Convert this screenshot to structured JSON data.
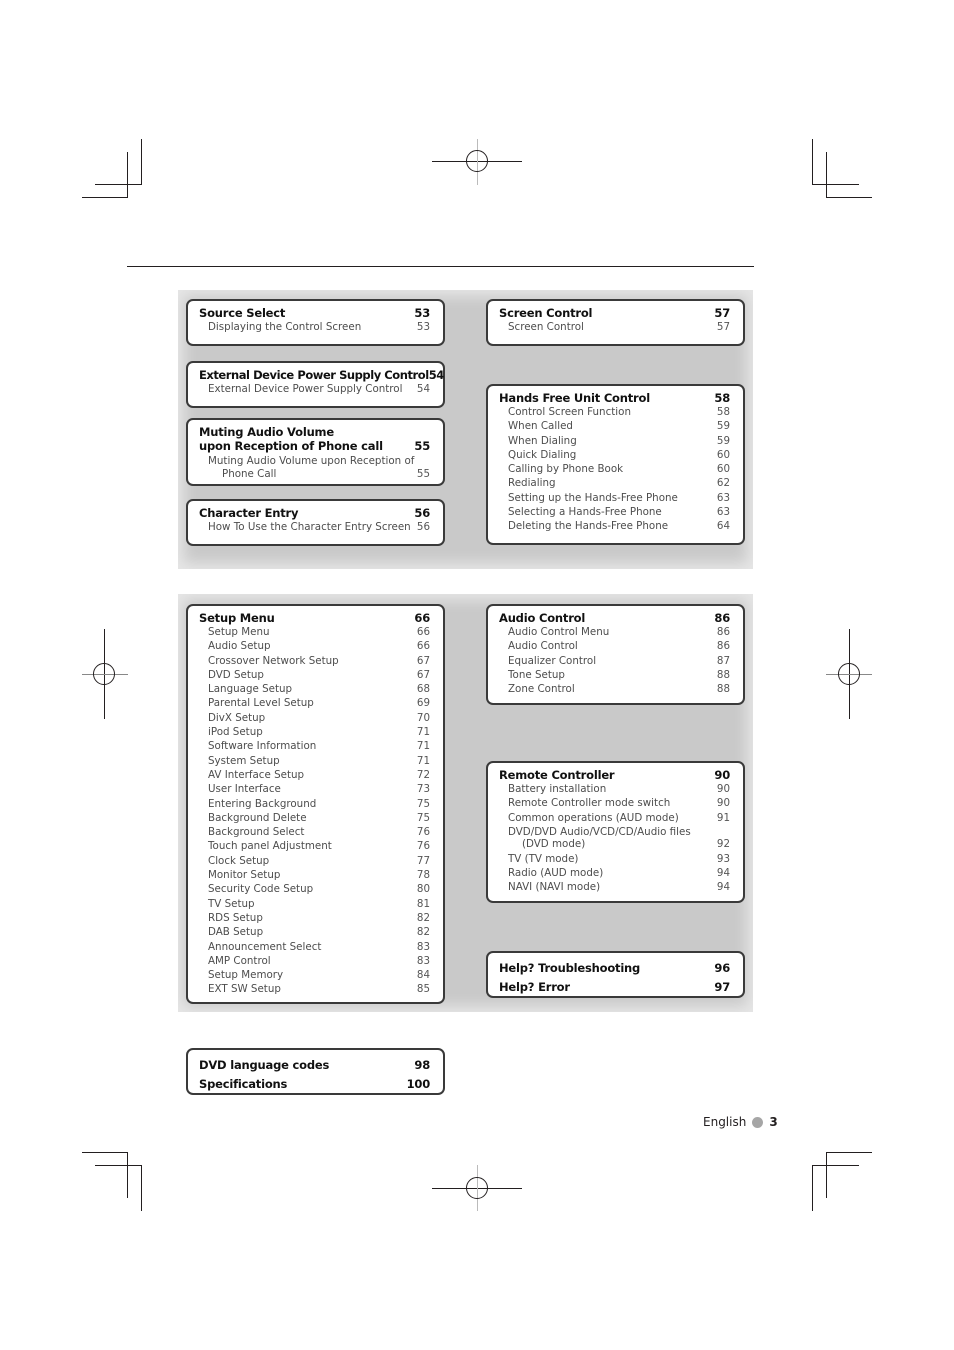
{
  "toc": {
    "group1_left": [
      {
        "title": "Source Select",
        "page": "53",
        "items": [
          {
            "label": "Displaying the Control Screen",
            "page": "53"
          }
        ]
      },
      {
        "title": "External Device Power Supply Control",
        "page": "54",
        "items": [
          {
            "label": "External Device Power Supply Control",
            "page": "54"
          }
        ]
      },
      {
        "title_line1": "Muting Audio Volume",
        "title_line2": "upon Reception of Phone call",
        "page": "55",
        "items": [
          {
            "label_line1": "Muting Audio Volume upon Reception of",
            "label_line2": "Phone Call",
            "page": "55"
          }
        ]
      },
      {
        "title": "Character Entry",
        "page": "56",
        "items": [
          {
            "label": "How To Use the Character Entry Screen",
            "page": "56"
          }
        ]
      }
    ],
    "group1_right": [
      {
        "title": "Screen Control",
        "page": "57",
        "items": [
          {
            "label": "Screen Control",
            "page": "57"
          }
        ]
      },
      {
        "title": "Hands Free Unit Control",
        "page": "58",
        "items": [
          {
            "label": "Control Screen Function",
            "page": "58"
          },
          {
            "label": "When Called",
            "page": "59"
          },
          {
            "label": "When Dialing",
            "page": "59"
          },
          {
            "label": "Quick Dialing",
            "page": "60"
          },
          {
            "label": "Calling by Phone Book",
            "page": "60"
          },
          {
            "label": "Redialing",
            "page": "62"
          },
          {
            "label": "Setting up the Hands-Free Phone",
            "page": "63"
          },
          {
            "label": "Selecting a Hands-Free Phone",
            "page": "63"
          },
          {
            "label": "Deleting the Hands-Free Phone",
            "page": "64"
          }
        ]
      }
    ],
    "group2_left": [
      {
        "title": "Setup Menu",
        "page": "66",
        "items": [
          {
            "label": "Setup Menu",
            "page": "66"
          },
          {
            "label": "Audio Setup",
            "page": "66"
          },
          {
            "label": "Crossover Network Setup",
            "page": "67"
          },
          {
            "label": "DVD Setup",
            "page": "67"
          },
          {
            "label": "Language Setup",
            "page": "68"
          },
          {
            "label": "Parental Level Setup",
            "page": "69"
          },
          {
            "label": "DivX Setup",
            "page": "70"
          },
          {
            "label": "iPod Setup",
            "page": "71"
          },
          {
            "label": "Software Information",
            "page": "71"
          },
          {
            "label": "System Setup",
            "page": "71"
          },
          {
            "label": "AV Interface Setup",
            "page": "72"
          },
          {
            "label": "User Interface",
            "page": "73"
          },
          {
            "label": "Entering Background",
            "page": "75"
          },
          {
            "label": "Background Delete",
            "page": "75"
          },
          {
            "label": "Background Select",
            "page": "76"
          },
          {
            "label": "Touch panel Adjustment",
            "page": "76"
          },
          {
            "label": "Clock Setup",
            "page": "77"
          },
          {
            "label": "Monitor Setup",
            "page": "78"
          },
          {
            "label": "Security Code Setup",
            "page": "80"
          },
          {
            "label": "TV Setup",
            "page": "81"
          },
          {
            "label": "RDS Setup",
            "page": "82"
          },
          {
            "label": "DAB Setup",
            "page": "82"
          },
          {
            "label": "Announcement Select",
            "page": "83"
          },
          {
            "label": "AMP Control",
            "page": "83"
          },
          {
            "label": "Setup Memory",
            "page": "84"
          },
          {
            "label": "EXT SW Setup",
            "page": "85"
          }
        ]
      }
    ],
    "group2_right": [
      {
        "title": "Audio Control",
        "page": "86",
        "items": [
          {
            "label": "Audio Control Menu",
            "page": "86"
          },
          {
            "label": "Audio Control",
            "page": "86"
          },
          {
            "label": "Equalizer Control",
            "page": "87"
          },
          {
            "label": "Tone Setup",
            "page": "88"
          },
          {
            "label": "Zone Control",
            "page": "88"
          }
        ]
      },
      {
        "title": "Remote Controller",
        "page": "90",
        "items": [
          {
            "label": "Battery installation",
            "page": "90"
          },
          {
            "label": "Remote Controller mode switch",
            "page": "90"
          },
          {
            "label": "Common operations (AUD mode)",
            "page": "91"
          },
          {
            "label_line1": "DVD/DVD Audio/VCD/CD/Audio files",
            "label_line2": "(DVD mode)",
            "page": "92"
          },
          {
            "label": "TV (TV mode)",
            "page": "93"
          },
          {
            "label": "Radio (AUD mode)",
            "page": "94"
          },
          {
            "label": "NAVI (NAVI mode)",
            "page": "94"
          }
        ]
      },
      {
        "headings": [
          {
            "title": "Help? Troubleshooting",
            "page": "96"
          },
          {
            "title": "Help? Error",
            "page": "97"
          }
        ]
      }
    ],
    "appendix": {
      "headings": [
        {
          "title": "DVD language codes",
          "page": "98"
        },
        {
          "title": "Specifications",
          "page": "100"
        }
      ]
    }
  },
  "footer": {
    "language": "English",
    "page_number": "3"
  }
}
